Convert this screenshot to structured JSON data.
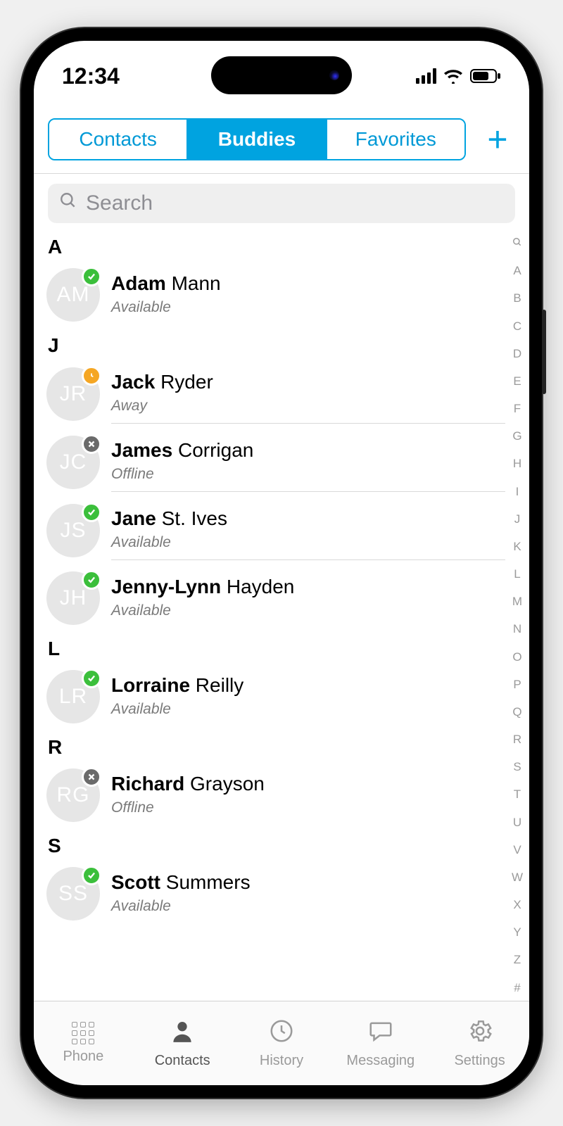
{
  "status_bar": {
    "time": "12:34"
  },
  "header": {
    "tabs": [
      "Contacts",
      "Buddies",
      "Favorites"
    ],
    "active_tab_index": 1
  },
  "search": {
    "placeholder": "Search",
    "value": ""
  },
  "index_rail": [
    "A",
    "B",
    "C",
    "D",
    "E",
    "F",
    "G",
    "H",
    "I",
    "J",
    "K",
    "L",
    "M",
    "N",
    "O",
    "P",
    "Q",
    "R",
    "S",
    "T",
    "U",
    "V",
    "W",
    "X",
    "Y",
    "Z",
    "#"
  ],
  "sections": [
    {
      "letter": "A",
      "contacts": [
        {
          "initials": "AM",
          "first": "Adam",
          "last": "Mann",
          "status": "Available",
          "presence": "available"
        }
      ]
    },
    {
      "letter": "J",
      "contacts": [
        {
          "initials": "JR",
          "first": "Jack",
          "last": "Ryder",
          "status": "Away",
          "presence": "away"
        },
        {
          "initials": "JC",
          "first": "James",
          "last": "Corrigan",
          "status": "Offline",
          "presence": "offline"
        },
        {
          "initials": "JS",
          "first": "Jane",
          "last": "St. Ives",
          "status": "Available",
          "presence": "available"
        },
        {
          "initials": "JH",
          "first": "Jenny-Lynn",
          "last": "Hayden",
          "status": "Available",
          "presence": "available"
        }
      ]
    },
    {
      "letter": "L",
      "contacts": [
        {
          "initials": "LR",
          "first": "Lorraine",
          "last": "Reilly",
          "status": "Available",
          "presence": "available"
        }
      ]
    },
    {
      "letter": "R",
      "contacts": [
        {
          "initials": "RG",
          "first": "Richard",
          "last": "Grayson",
          "status": "Offline",
          "presence": "offline"
        }
      ]
    },
    {
      "letter": "S",
      "contacts": [
        {
          "initials": "SS",
          "first": "Scott",
          "last": "Summers",
          "status": "Available",
          "presence": "available"
        }
      ]
    }
  ],
  "tabbar": {
    "items": [
      {
        "icon": "dialpad",
        "label": "Phone"
      },
      {
        "icon": "person",
        "label": "Contacts"
      },
      {
        "icon": "clock",
        "label": "History"
      },
      {
        "icon": "message",
        "label": "Messaging"
      },
      {
        "icon": "gear",
        "label": "Settings"
      }
    ],
    "active_index": 1
  },
  "presence_labels": {
    "available": "Available",
    "away": "Away",
    "offline": "Offline"
  }
}
